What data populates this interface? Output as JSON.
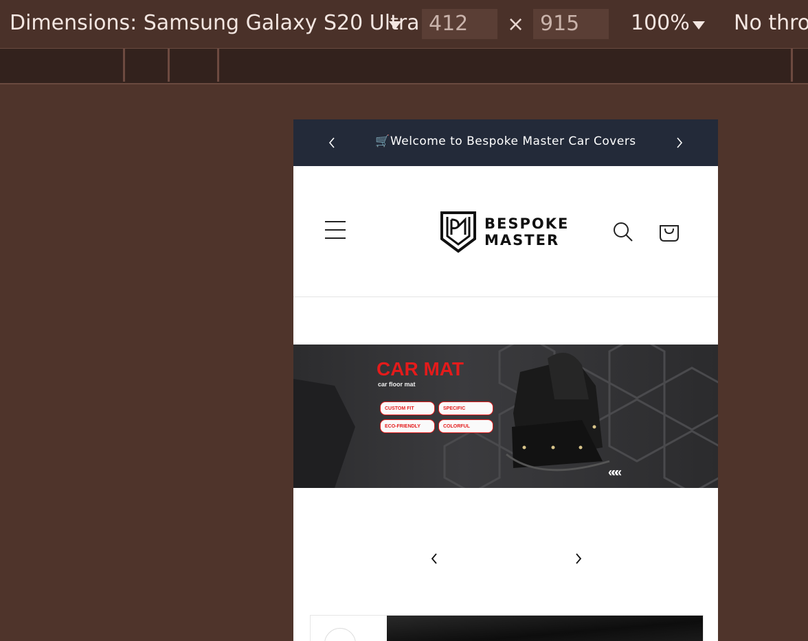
{
  "devtools": {
    "dimensions_label": "Dimensions: Samsung Galaxy S20 Ultra",
    "width": "412",
    "times": "×",
    "height": "915",
    "zoom": "100%",
    "throttle": "No thro"
  },
  "announcement": {
    "text": "🛒Welcome to Bespoke Master Car Covers",
    "prev_icon": "chevron-left-icon",
    "next_icon": "chevron-right-icon"
  },
  "header": {
    "menu_icon": "hamburger-menu-icon",
    "logo_line1": "BESPOKE",
    "logo_line2": "MASTER",
    "search_icon": "search-icon",
    "cart_icon": "cart-bag-icon"
  },
  "banner": {
    "headline": "CAR MAT",
    "subheadline": "car floor mat",
    "chips": [
      "CUSTOM FIT",
      "SPECIFIC",
      "ECO-FRIENDLY",
      "COLORFUL"
    ],
    "arrows": "«««"
  },
  "slider": {
    "prev_icon": "chevron-left-icon",
    "next_icon": "chevron-right-icon"
  },
  "colors": {
    "devtools_bg": "#4f342b",
    "announce_bg": "#232a39",
    "accent_red": "#e41b1b"
  }
}
